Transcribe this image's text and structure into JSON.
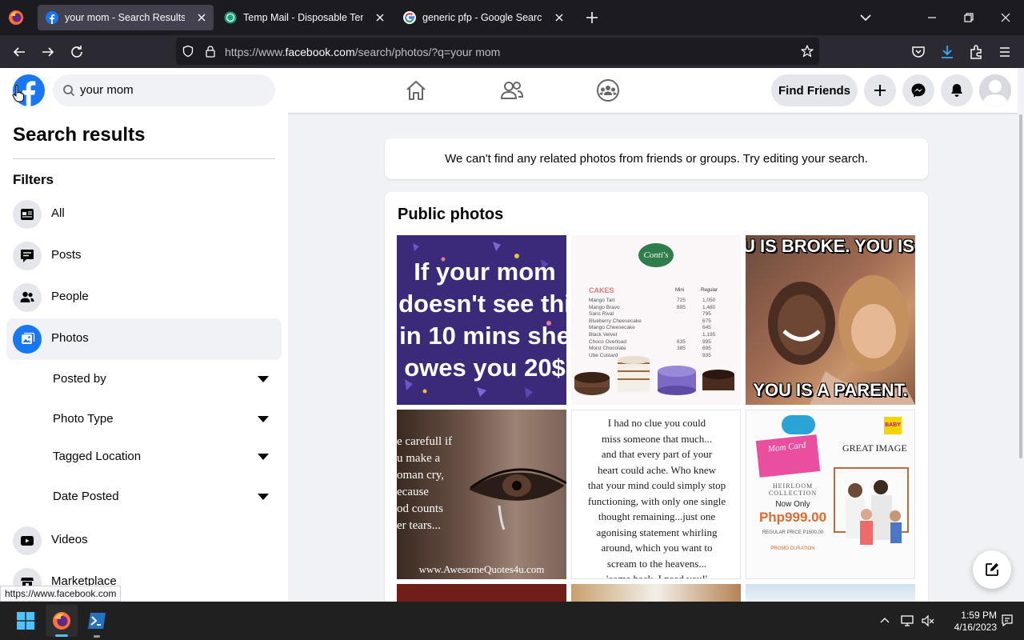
{
  "browser": {
    "tabs": [
      {
        "title": "your mom - Search Results | Facebook",
        "favicon": "facebook-favicon",
        "active": true
      },
      {
        "title": "Temp Mail - Disposable Temporary Email",
        "favicon": "tempmail-favicon",
        "active": false
      },
      {
        "title": "generic pfp - Google Search",
        "favicon": "google-favicon",
        "active": false
      }
    ],
    "url_prefix": "https://www.",
    "url_domain": "facebook.com",
    "url_path": "/search/photos/?q=your mom",
    "status_link": "https://www.facebook.com"
  },
  "header": {
    "search_value": "your mom",
    "find_friends_label": "Find Friends",
    "icons": [
      "home-icon",
      "friends-icon",
      "groups-icon",
      "plus-icon",
      "messenger-icon",
      "bell-icon"
    ]
  },
  "sidebar": {
    "title": "Search results",
    "filters_label": "Filters",
    "items": [
      {
        "label": "All",
        "icon": "all-icon",
        "selected": false
      },
      {
        "label": "Posts",
        "icon": "posts-icon",
        "selected": false
      },
      {
        "label": "People",
        "icon": "people-icon",
        "selected": false
      },
      {
        "label": "Photos",
        "icon": "photos-icon",
        "selected": true
      },
      {
        "label": "Videos",
        "icon": "videos-icon",
        "selected": false
      },
      {
        "label": "Marketplace",
        "icon": "marketplace-icon",
        "selected": false
      }
    ],
    "subfilters": [
      {
        "label": "Posted by"
      },
      {
        "label": "Photo Type"
      },
      {
        "label": "Tagged Location"
      },
      {
        "label": "Date Posted"
      }
    ]
  },
  "main": {
    "notice": "We can't find any related photos from friends or groups. Try editing your search.",
    "public_photos_title": "Public photos",
    "photos": [
      {
        "lines": [
          "If your mom",
          "doesn't see thi",
          "in 10 mins she",
          "owes you 20$"
        ]
      },
      {
        "brand": "Conti's",
        "heading": "CAKES",
        "col1": "Mini",
        "col2": "Regular",
        "items": [
          [
            "Mango Tart",
            "725",
            "1,050"
          ],
          [
            "Mango Bravo",
            "895",
            "1,480"
          ],
          [
            "Sans Rival",
            "",
            "795"
          ],
          [
            "Blueberry Cheesecake",
            "",
            "675"
          ],
          [
            "Mango Cheesecake",
            "",
            "645"
          ],
          [
            "Black Velvet",
            "",
            "1,195"
          ],
          [
            "Choco Overload",
            "635",
            "995"
          ],
          [
            "Moist Chocolate",
            "385",
            "695"
          ],
          [
            "Ube Custard",
            "",
            "935"
          ]
        ]
      },
      {
        "top": "U IS BROKE. YOU IS TIR",
        "bottom": "YOU IS A PARENT."
      },
      {
        "lines": [
          "e carefull if",
          "u make a",
          "oman cry,",
          "ecause",
          "od counts",
          "er tears..."
        ],
        "footer": "www.AwesomeQuotes4u.com"
      },
      {
        "lines": [
          "I had no clue you could",
          "miss someone that much...",
          "and that every part of your",
          "heart could ache. Who knew",
          "that your mind could simply stop",
          "functioning, with only one single",
          "thought remaining...just one",
          "agonising statement whirling",
          "around, which you want to",
          "scream to the heavens...",
          "'come back, I need you!'"
        ]
      },
      {
        "badge": "BABY",
        "card": "Mom Card",
        "brand": "GREAT IMAGE",
        "collection": "HEIRLOOM COLLECTION",
        "now_only": "Now Only",
        "price": "Php999.00",
        "regular": "REGULAR PRICE P1500.00",
        "promo": "PROMO DURATION"
      }
    ]
  },
  "taskbar": {
    "time": "1:59 PM",
    "date": "4/16/2023"
  },
  "colors": {
    "fb_blue": "#1877f2",
    "browser_dark": "#1c1b22",
    "toolbar": "#2b2a33"
  }
}
